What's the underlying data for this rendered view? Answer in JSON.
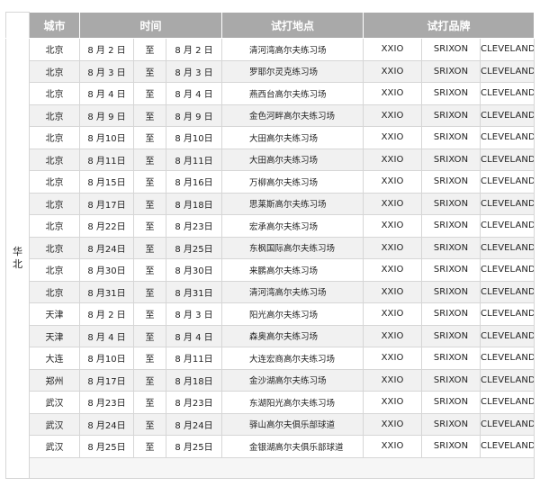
{
  "header": {
    "city": "城市",
    "time": "时间",
    "venue": "试打地点",
    "brands": "试打品牌"
  },
  "region": "华北",
  "rows": [
    {
      "city": "北京",
      "start": "8 月 2 日",
      "to": "至",
      "end": "8 月 2 日",
      "venue": "清河湾高尔夫练习场",
      "b1": "XXIO",
      "b2": "SRIXON",
      "b3": "CLEVELAND"
    },
    {
      "city": "北京",
      "start": "8 月 3 日",
      "to": "至",
      "end": "8 月 3 日",
      "venue": "罗耶尔灵克练习场",
      "b1": "XXIO",
      "b2": "SRIXON",
      "b3": "CLEVELAND"
    },
    {
      "city": "北京",
      "start": "8 月 4 日",
      "to": "至",
      "end": "8 月 4 日",
      "venue": "燕西台高尔夫练习场",
      "b1": "XXIO",
      "b2": "SRIXON",
      "b3": "CLEVELAND"
    },
    {
      "city": "北京",
      "start": "8 月 9 日",
      "to": "至",
      "end": "8 月 9 日",
      "venue": "金色河畔高尔夫练习场",
      "b1": "XXIO",
      "b2": "SRIXON",
      "b3": "CLEVELAND"
    },
    {
      "city": "北京",
      "start": "8 月10日",
      "to": "至",
      "end": "8 月10日",
      "venue": "大田高尔夫练习场",
      "b1": "XXIO",
      "b2": "SRIXON",
      "b3": "CLEVELAND"
    },
    {
      "city": "北京",
      "start": "8 月11日",
      "to": "至",
      "end": "8 月11日",
      "venue": "大田高尔夫练习场",
      "b1": "XXIO",
      "b2": "SRIXON",
      "b3": "CLEVELAND"
    },
    {
      "city": "北京",
      "start": "8 月15日",
      "to": "至",
      "end": "8 月16日",
      "venue": "万柳高尔夫练习场",
      "b1": "XXIO",
      "b2": "SRIXON",
      "b3": "CLEVELAND"
    },
    {
      "city": "北京",
      "start": "8 月17日",
      "to": "至",
      "end": "8 月18日",
      "venue": "思莱斯高尔夫练习场",
      "b1": "XXIO",
      "b2": "SRIXON",
      "b3": "CLEVELAND"
    },
    {
      "city": "北京",
      "start": "8 月22日",
      "to": "至",
      "end": "8 月23日",
      "venue": "宏承高尔夫练习场",
      "b1": "XXIO",
      "b2": "SRIXON",
      "b3": "CLEVELAND"
    },
    {
      "city": "北京",
      "start": "8 月24日",
      "to": "至",
      "end": "8 月25日",
      "venue": "东枫国际高尔夫练习场",
      "b1": "XXIO",
      "b2": "SRIXON",
      "b3": "CLEVELAND"
    },
    {
      "city": "北京",
      "start": "8 月30日",
      "to": "至",
      "end": "8 月30日",
      "venue": "来鹏高尔夫练习场",
      "b1": "XXIO",
      "b2": "SRIXON",
      "b3": "CLEVELAND"
    },
    {
      "city": "北京",
      "start": "8 月31日",
      "to": "至",
      "end": "8 月31日",
      "venue": "清河湾高尔夫练习场",
      "b1": "XXIO",
      "b2": "SRIXON",
      "b3": "CLEVELAND"
    },
    {
      "city": "天津",
      "start": "8 月 2 日",
      "to": "至",
      "end": "8 月 3 日",
      "venue": "阳光高尔夫练习场",
      "b1": "XXIO",
      "b2": "SRIXON",
      "b3": "CLEVELAND"
    },
    {
      "city": "天津",
      "start": "8 月 4 日",
      "to": "至",
      "end": "8 月 4 日",
      "venue": "森奥高尔夫练习场",
      "b1": "XXIO",
      "b2": "SRIXON",
      "b3": "CLEVELAND"
    },
    {
      "city": "大连",
      "start": "8 月10日",
      "to": "至",
      "end": "8 月11日",
      "venue": "大连宏商高尔夫练习场",
      "b1": "XXIO",
      "b2": "SRIXON",
      "b3": "CLEVELAND"
    },
    {
      "city": "郑州",
      "start": "8 月17日",
      "to": "至",
      "end": "8 月18日",
      "venue": "金沙湖高尔夫练习场",
      "b1": "XXIO",
      "b2": "SRIXON",
      "b3": "CLEVELAND"
    },
    {
      "city": "武汉",
      "start": "8 月23日",
      "to": "至",
      "end": "8 月23日",
      "venue": "东湖阳光高尔夫练习场",
      "b1": "XXIO",
      "b2": "SRIXON",
      "b3": "CLEVELAND"
    },
    {
      "city": "武汉",
      "start": "8 月24日",
      "to": "至",
      "end": "8 月24日",
      "venue": "驿山高尔夫俱乐部球道",
      "b1": "XXIO",
      "b2": "SRIXON",
      "b3": "CLEVELAND"
    },
    {
      "city": "武汉",
      "start": "8 月25日",
      "to": "至",
      "end": "8 月25日",
      "venue": "金银湖高尔夫俱乐部球道",
      "b1": "XXIO",
      "b2": "SRIXON",
      "b3": "CLEVELAND"
    }
  ],
  "colors": {
    "header_bg": "#a9a9a9",
    "stripe": "#f1f1f1",
    "border": "#d6d6d6"
  }
}
